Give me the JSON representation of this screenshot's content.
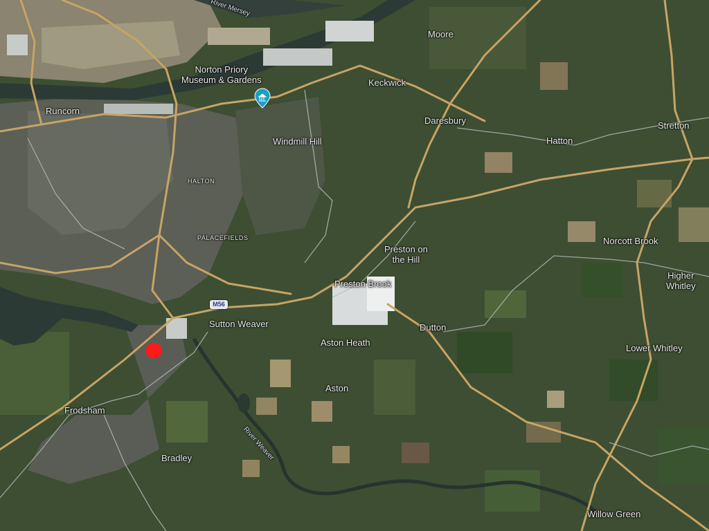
{
  "labels": {
    "river_mersey": "River Mersey",
    "runcorn": "Runcorn",
    "norton_priory": "Norton Priory\nMuseum & Gardens",
    "moore": "Moore",
    "keckwick": "Keckwick",
    "daresbury": "Daresbury",
    "windmill_hill": "Windmill Hill",
    "halton": "HALTON",
    "hatton": "Hatton",
    "stretton": "Stretton",
    "palacefields": "PALACEFIELDS",
    "norcott_brook": "Norcott Brook",
    "preston_on_the_hill": "Preston on\nthe Hill",
    "higher_whitley": "Higher\nWhitley",
    "preston_brook": "Preston Brook",
    "sutton_weaver": "Sutton Weaver",
    "dutton": "Dutton",
    "aston_heath": "Aston Heath",
    "lower_whitley": "Lower Whitley",
    "aston": "Aston",
    "frodsham": "Frodsham",
    "river_weaver": "River Weaver",
    "bradley": "Bradley",
    "willow_green": "Willow Green",
    "motorway_shield": "M56"
  },
  "icons": {
    "poi": "museum-pin-icon",
    "location": "red-location-dot-icon"
  },
  "colors": {
    "road": "#c8a464",
    "water": "#2c3a36",
    "urban": "#5e6258",
    "industrial": "#d8dcdc",
    "poi_marker": "#1b9fc4",
    "location_dot": "#ff1a1a"
  }
}
